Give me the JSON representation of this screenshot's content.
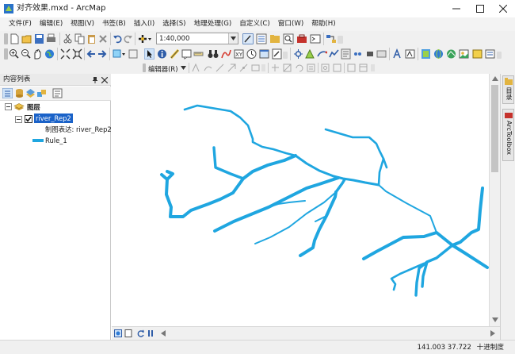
{
  "window": {
    "title": "对齐效果.mxd - ArcMap"
  },
  "menu": [
    "文件(F)",
    "编辑(E)",
    "视图(V)",
    "书签(B)",
    "插入(I)",
    "选择(S)",
    "地理处理(G)",
    "自定义(C)",
    "窗口(W)",
    "帮助(H)"
  ],
  "toolbar": {
    "scale_value": "1:40,000",
    "editor_label": "编辑器(R)"
  },
  "toc": {
    "title": "内容列表",
    "root_label": "图层",
    "layer_name": "river_Rep2",
    "representation_label": "制图表达: river_Rep2",
    "rule_label": "Rule_1"
  },
  "right_dock": {
    "tab1": "目录",
    "tab2": "ArcToolbox"
  },
  "status": {
    "coordinates": "141.003  37.722",
    "units": "十进制度"
  },
  "colors": {
    "river": "#1fa6e0",
    "selection": "#1a62c8",
    "titlebar": "#ffffff",
    "toolbar": "#f0f0f0"
  }
}
